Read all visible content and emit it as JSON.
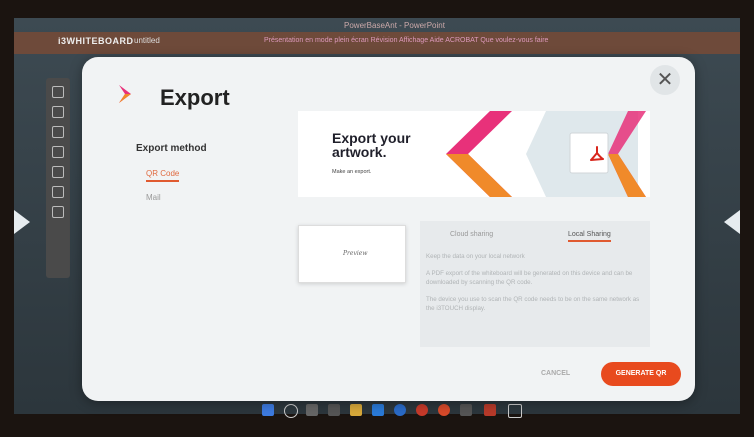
{
  "background_app": {
    "app_name": "i3WHITEBOARD",
    "doc_name": "untitled",
    "window_title": "PowerBaseAnt - PowerPoint",
    "menu_text": "Présentation en mode plein écran  Révision  Affichage  Aide  ACROBAT  Que voulez-vous faire"
  },
  "dialog": {
    "title": "Export",
    "close_label": "✕",
    "export_method": {
      "label": "Export method",
      "options": [
        "QR Code",
        "Mail"
      ],
      "selected": "QR Code"
    },
    "banner": {
      "headline": "Export your artwork.",
      "subtext": "Make an export."
    },
    "thumbnail_text": "Preview",
    "tabs": [
      "Cloud sharing",
      "Local Sharing"
    ],
    "active_tab": "Local Sharing",
    "description": {
      "p1": "Keep the data on your local network",
      "p2": "A PDF export of the whiteboard will be generated on this device and can be downloaded by scanning the QR code.",
      "p3": "The device you use to scan the QR code needs to be on the same network as the i3TOUCH display."
    },
    "cancel_label": "CANCEL",
    "generate_label": "GENERATE QR"
  },
  "colors": {
    "accent": "#e84a1e",
    "dialog_bg": "#f1f3f4",
    "pink": "#e8317a",
    "orange": "#f08a2a"
  },
  "icons": [
    "i3-logo-icon",
    "close-icon",
    "pdf-icon",
    "nav-left-icon",
    "nav-right-icon"
  ]
}
